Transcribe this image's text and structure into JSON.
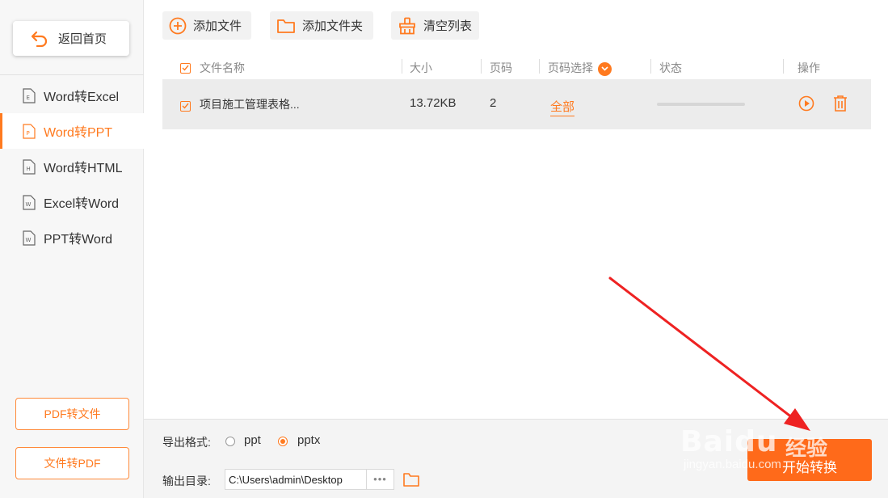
{
  "sidebar": {
    "back_label": "返回首页",
    "nav": [
      {
        "label": "Word转Excel",
        "icon": "E",
        "active": false
      },
      {
        "label": "Word转PPT",
        "icon": "P",
        "active": true
      },
      {
        "label": "Word转HTML",
        "icon": "H",
        "active": false
      },
      {
        "label": "Excel转Word",
        "icon": "W",
        "active": false
      },
      {
        "label": "PPT转Word",
        "icon": "W",
        "active": false
      }
    ],
    "pdf_to_file_label": "PDF转文件",
    "file_to_pdf_label": "文件转PDF"
  },
  "toolbar": {
    "add_file_label": "添加文件",
    "add_folder_label": "添加文件夹",
    "clear_list_label": "清空列表"
  },
  "table": {
    "headers": {
      "name": "文件名称",
      "size": "大小",
      "pages": "页码",
      "page_select": "页码选择",
      "status": "状态",
      "actions": "操作"
    },
    "rows": [
      {
        "name": "项目施工管理表格...",
        "size": "13.72KB",
        "pages": "2",
        "page_select": "全部",
        "progress": 0
      }
    ]
  },
  "bottom": {
    "format_label": "导出格式:",
    "format_options": [
      "ppt",
      "pptx"
    ],
    "format_selected": "pptx",
    "output_label": "输出目录:",
    "output_path": "C:\\Users\\admin\\Desktop",
    "browse_label": "•••",
    "start_label": "开始转换"
  },
  "watermark": {
    "logo": "Baidu",
    "cn": "经验",
    "url": "jingyan.baidu.com"
  },
  "colors": {
    "accent": "#ff7a1f",
    "button": "#ff6a1a",
    "arrow": "#ee2222"
  }
}
